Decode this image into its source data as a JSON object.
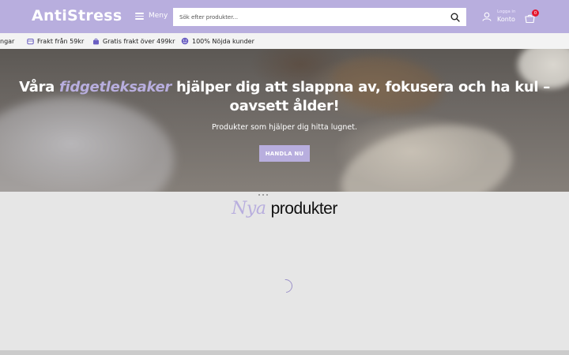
{
  "header": {
    "logo": "AntiStress",
    "menu_label": "Meny",
    "search_placeholder": "Sök efter produkter...",
    "account_small": "Logga in",
    "account_label": "Konto",
    "cart_count": "0"
  },
  "usp": [
    {
      "label": "ngar",
      "icon": "truncated-icon"
    },
    {
      "label": "Frakt från 59kr",
      "icon": "truck-icon"
    },
    {
      "label": "Gratis frakt över 499kr",
      "icon": "bag-icon"
    },
    {
      "label": "100% Nöjda kunder",
      "icon": "smile-icon"
    }
  ],
  "hero": {
    "title_part1": "Våra ",
    "title_accent": "fidgetleksaker",
    "title_part2": " hjälper dig att slappna av, fokusera och ha kul – oavsett ålder!",
    "subtitle": "Produkter som hjälper dig hitta lugnet.",
    "cta": "HANDLA NU"
  },
  "section": {
    "title_script": "Nya",
    "title_plain": "produkter"
  },
  "colors": {
    "brand": "#b8aede",
    "badge": "#e4162d"
  }
}
